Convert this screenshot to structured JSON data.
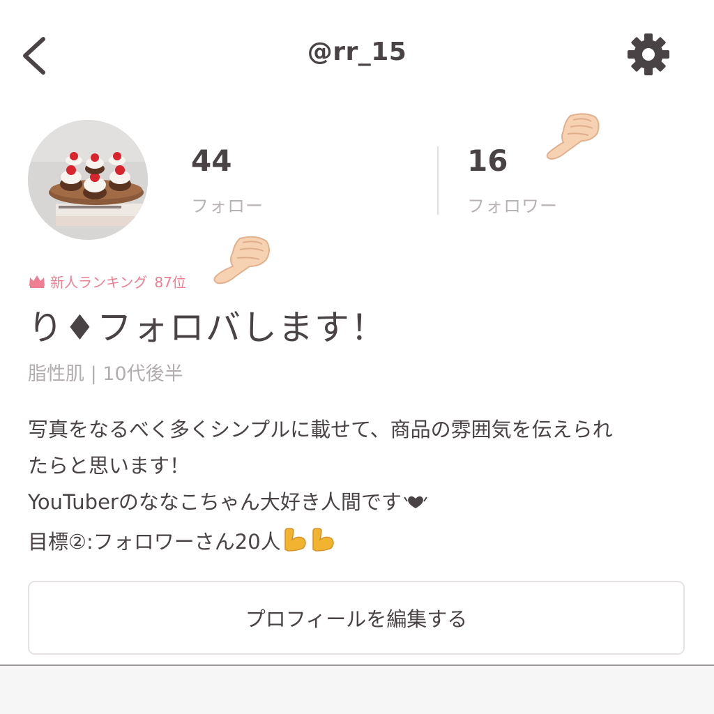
{
  "header": {
    "username": "@rr_15",
    "back_icon": "chevron-left-icon",
    "settings_icon": "gear-icon"
  },
  "profile": {
    "avatar_description_icon": "avatar-cupcakes",
    "stats": {
      "follow_count": "44",
      "follow_label": "フォロー",
      "follower_count": "16",
      "follower_label": "フォロワー"
    },
    "ranking": {
      "label": "新人ランキング",
      "rank": "87位"
    },
    "display_name": "り♦フォロバします！",
    "tags": "脂性肌 | 10代後半",
    "bio": {
      "line1": "写真をなるべく多くシンプルに載せて、商品の雰囲気を伝えられ",
      "line2": "たらと思います！",
      "line3": "YouTuberのななこちゃん大好き人間です",
      "line4": "目標②:フォロワーさん20人"
    },
    "edit_button_label": "プロフィールを編集する"
  },
  "colors": {
    "text": "#4a4346",
    "muted": "#b9b3b5",
    "accent_pink": "#ef7e93",
    "border": "#e7e3e4"
  }
}
